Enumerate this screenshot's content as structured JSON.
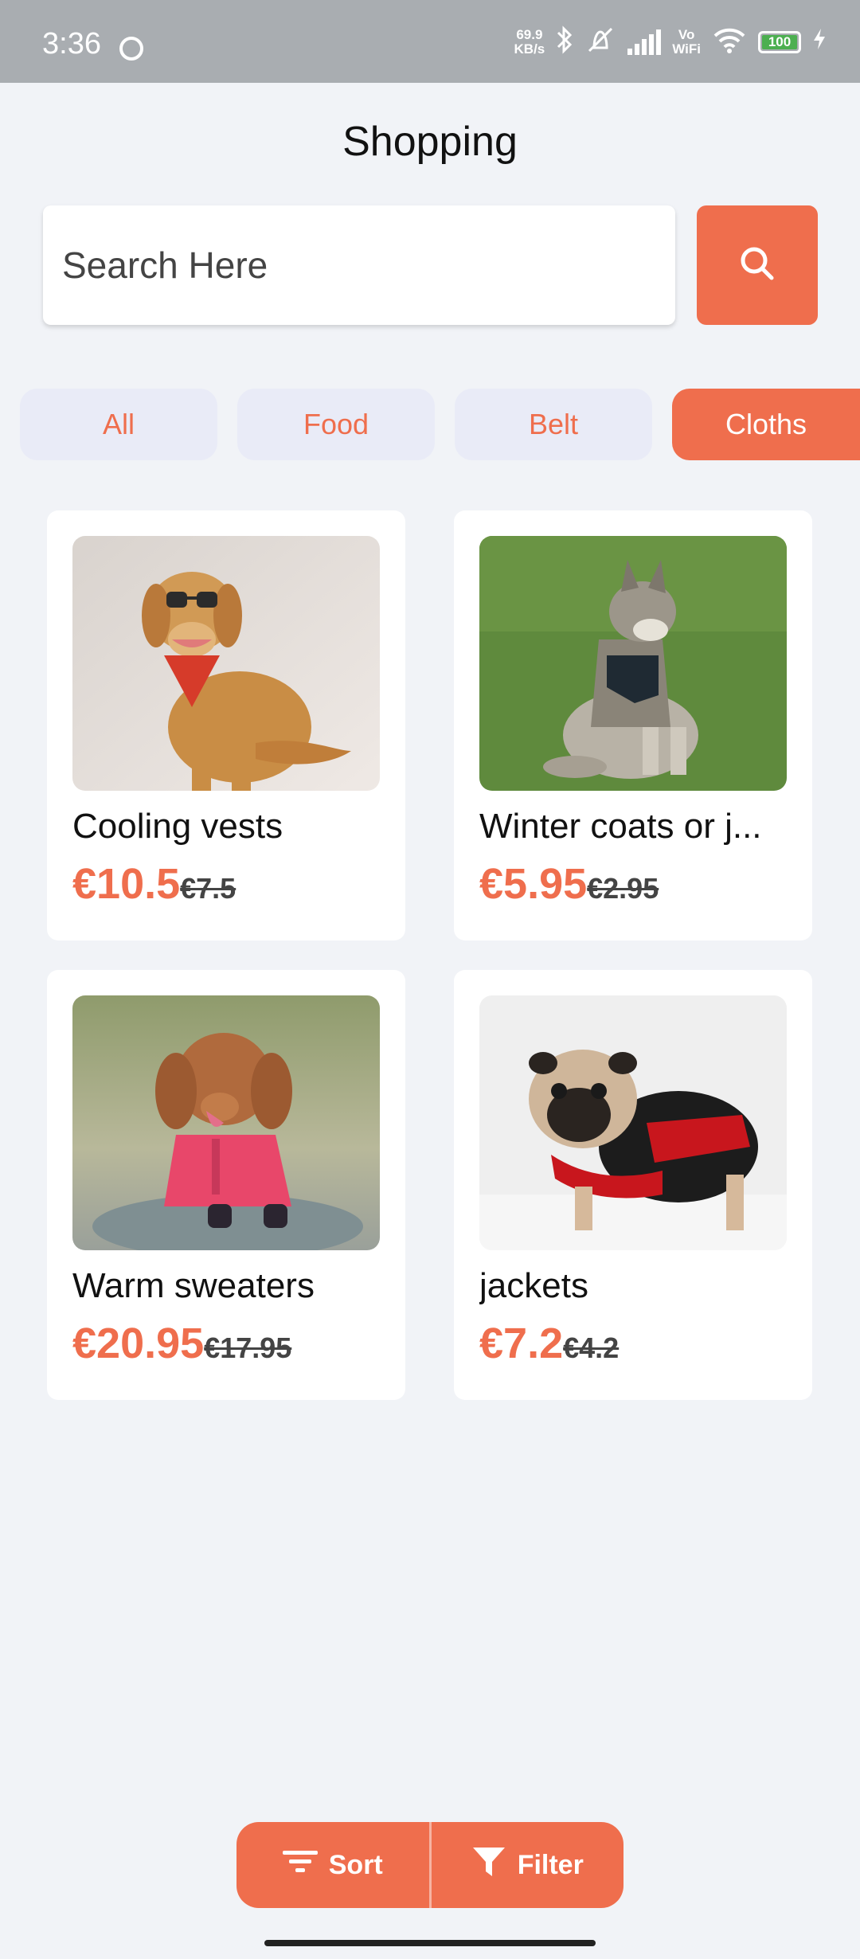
{
  "status_bar": {
    "time": "3:36",
    "net_speed_value": "69.9",
    "net_speed_unit": "KB/s",
    "wifi_label_top": "Vo",
    "wifi_label_bottom": "WiFi",
    "battery": "100"
  },
  "header": {
    "title": "Shopping"
  },
  "search": {
    "placeholder": "Search Here",
    "value": ""
  },
  "categories": [
    {
      "label": "All",
      "active": false
    },
    {
      "label": "Food",
      "active": false
    },
    {
      "label": "Belt",
      "active": false
    },
    {
      "label": "Cloths",
      "active": true
    }
  ],
  "products": [
    {
      "name": "Cooling vests",
      "price": "€10.5",
      "old_price": "€7.5",
      "image": "golden retriever with sunglasses and red bandana"
    },
    {
      "name": "Winter coats or j...",
      "price": "€5.95",
      "old_price": "€2.95",
      "image": "wolfdog in harness sitting on grass"
    },
    {
      "name": "Warm sweaters",
      "price": "€20.95",
      "old_price": "€17.95",
      "image": "poodle in pink jacket"
    },
    {
      "name": "jackets",
      "price": "€7.2",
      "old_price": "€4.2",
      "image": "pug in red and black sweater"
    }
  ],
  "bottom_bar": {
    "sort_label": "Sort",
    "filter_label": "Filter"
  },
  "colors": {
    "accent": "#ef6e4d",
    "chip_bg": "#e9ebf7",
    "page_bg": "#f1f3f7",
    "status_bar": "#a9adb1"
  }
}
